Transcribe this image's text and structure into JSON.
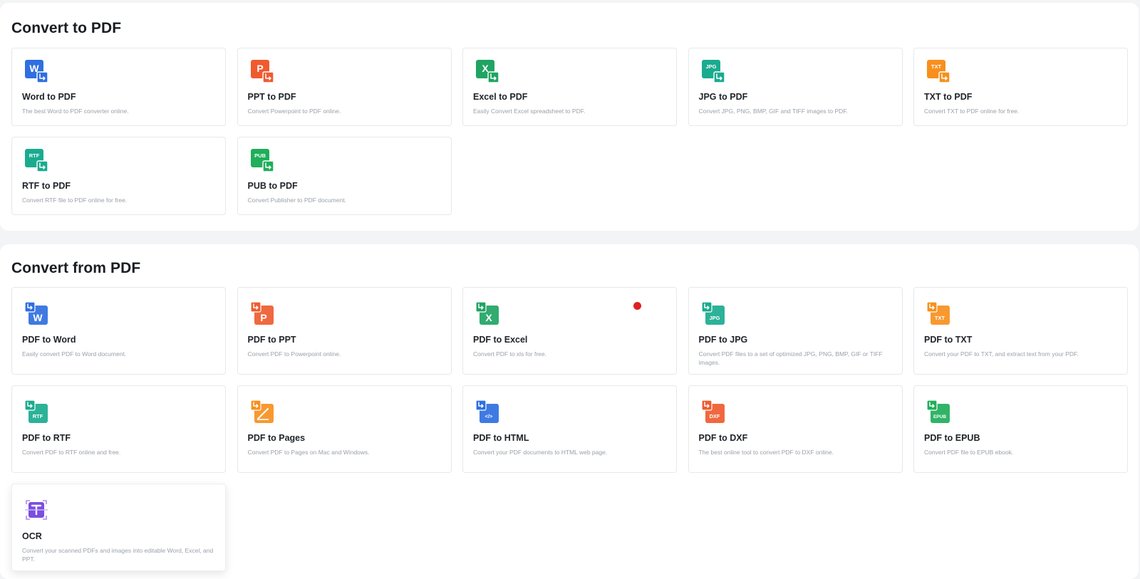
{
  "convert_to": {
    "title": "Convert to PDF",
    "cards": [
      {
        "title": "Word to PDF",
        "desc": "The best Word to PDF converter online.",
        "icon": "word-to-pdf-icon",
        "color": "#2f6fe0",
        "letter": "W"
      },
      {
        "title": "PPT to PDF",
        "desc": "Convert Powerpoint to PDF online.",
        "icon": "ppt-to-pdf-icon",
        "color": "#ef5b2f",
        "letter": "P"
      },
      {
        "title": "Excel to PDF",
        "desc": "Easily Convert Excel spreadsheet to PDF.",
        "icon": "excel-to-pdf-icon",
        "color": "#1fa463",
        "letter": "X"
      },
      {
        "title": "JPG to PDF",
        "desc": "Convert JPG, PNG, BMP, GIF and TIFF images to PDF.",
        "icon": "jpg-to-pdf-icon",
        "color": "#1aab8f",
        "letter": "JPG"
      },
      {
        "title": "TXT to PDF",
        "desc": "Convert TXT to PDF online for free.",
        "icon": "txt-to-pdf-icon",
        "color": "#f7901e",
        "letter": "TXT"
      },
      {
        "title": "RTF to PDF",
        "desc": "Convert RTF file to PDF online for free.",
        "icon": "rtf-to-pdf-icon",
        "color": "#1aab8f",
        "letter": "RTF"
      },
      {
        "title": "PUB to PDF",
        "desc": "Convert Publisher to PDF document.",
        "icon": "pub-to-pdf-icon",
        "color": "#1fae5a",
        "letter": "PUB"
      }
    ]
  },
  "convert_from": {
    "title": "Convert from PDF",
    "cards": [
      {
        "title": "PDF to Word",
        "desc": "Easily convert PDF to Word document.",
        "icon": "pdf-to-word-icon",
        "color": "#2f6fe0",
        "letter": "W"
      },
      {
        "title": "PDF to PPT",
        "desc": "Convert PDF to Powerpoint online.",
        "icon": "pdf-to-ppt-icon",
        "color": "#ef5b2f",
        "letter": "P"
      },
      {
        "title": "PDF to Excel",
        "desc": "Convert PDF to xls for free.",
        "icon": "pdf-to-excel-icon",
        "color": "#1fa463",
        "letter": "X"
      },
      {
        "title": "PDF to JPG",
        "desc": "Convert PDF files to a set of optimized JPG, PNG, BMP, GIF or TIFF images.",
        "icon": "pdf-to-jpg-icon",
        "color": "#1aab8f",
        "letter": "JPG"
      },
      {
        "title": "PDF to TXT",
        "desc": "Convert your PDF to TXT, and extract text from your PDF.",
        "icon": "pdf-to-txt-icon",
        "color": "#f7901e",
        "letter": "TXT"
      },
      {
        "title": "PDF to RTF",
        "desc": "Convert PDF to RTF online and free.",
        "icon": "pdf-to-rtf-icon",
        "color": "#1aab8f",
        "letter": "RTF"
      },
      {
        "title": "PDF to Pages",
        "desc": "Convert PDF to Pages on Mac and Windows.",
        "icon": "pdf-to-pages-icon",
        "color": "#f7901e",
        "letter": "pages"
      },
      {
        "title": "PDF to HTML",
        "desc": "Convert your PDF documents to HTML web page.",
        "icon": "pdf-to-html-icon",
        "color": "#2f6fe0",
        "letter": "</>"
      },
      {
        "title": "PDF to DXF",
        "desc": "The best online tool to convert PDF to DXF online.",
        "icon": "pdf-to-dxf-icon",
        "color": "#ef5b2f",
        "letter": "DXF"
      },
      {
        "title": "PDF to EPUB",
        "desc": "Convert PDF file to EPUB ebook.",
        "icon": "pdf-to-epub-icon",
        "color": "#1fae5a",
        "letter": "EPUB"
      },
      {
        "title": "OCR",
        "desc": "Convert your scanned PDFs and images into editable Word, Excel, and PPT.",
        "icon": "ocr-icon",
        "color": "#7b4fe0",
        "letter": "T"
      }
    ]
  },
  "colors": {
    "accent_red_dot": "#e02020"
  }
}
